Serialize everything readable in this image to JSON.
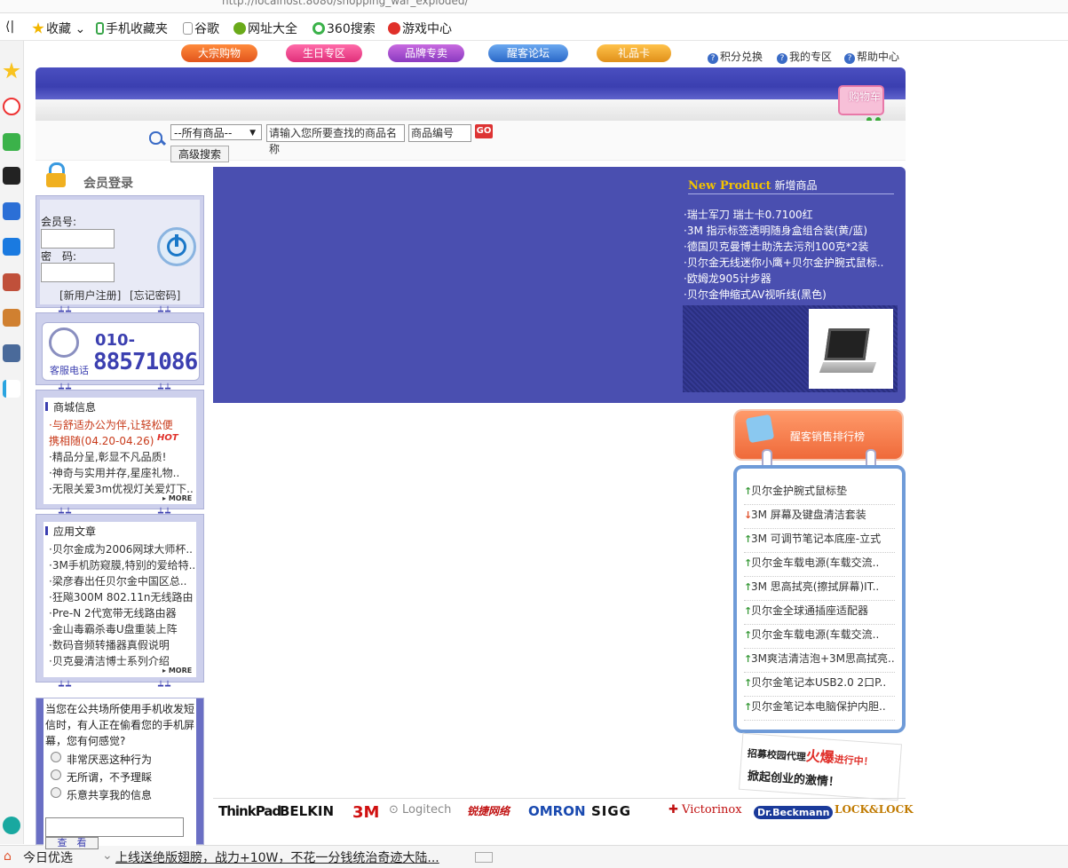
{
  "browser": {
    "url": "http://localhost:8080/shopping_war_exploded/",
    "back_label": "⟨|",
    "bookmarks": [
      {
        "label": "收藏",
        "icon": "star-icon"
      },
      {
        "label": "手机收藏夹",
        "icon": "phone-icon"
      },
      {
        "label": "谷歌",
        "icon": "page-icon"
      },
      {
        "label": "网址大全",
        "icon": "globe-icon"
      },
      {
        "label": "360搜索",
        "icon": "search360-icon"
      },
      {
        "label": "游戏中心",
        "icon": "game-icon"
      }
    ],
    "status": {
      "item1": "今日优选",
      "item2": "上线送绝版翅膀，战力+10W，不花一分钱统治奇迹大陆..."
    }
  },
  "nav": {
    "buttons": [
      "大宗购物",
      "生日专区",
      "品牌专卖",
      "醒客论坛",
      "礼品卡"
    ],
    "links": [
      "积分兑换",
      "我的专区",
      "帮助中心"
    ],
    "cart": "购物车"
  },
  "search": {
    "category": "--所有商品--",
    "keyword": "请输入您所要查找的商品名称",
    "code": "商品编号",
    "go": "GO",
    "advanced": "高级搜索"
  },
  "login": {
    "title": "会员登录",
    "member_label": "会员号:",
    "password_label": "密　码:",
    "register": "[新用户注册]",
    "forgot": "[忘记密码]"
  },
  "hotline": {
    "prefix": "010-",
    "number": "88571086",
    "caption": "客服电话"
  },
  "mall_info": {
    "title": "商城信息",
    "items": [
      "·与舒适办公为伴,让轻松便",
      "携相随(04.20-04.26)",
      "·精品分呈,彰显不凡品质!",
      "·神奇与实用并存,星座礼物..",
      "·无限关爱3m优视灯关爱灯下.."
    ],
    "hot": "HOT",
    "more": "MORE"
  },
  "articles": {
    "title": "应用文章",
    "items": [
      "·贝尔金成为2006网球大师杯..",
      "·3M手机防窥膜,特别的爱给特..",
      "·梁彦春出任贝尔金中国区总..",
      "·狂飚300M 802.11n无线路由",
      "·Pre-N 2代宽带无线路由器",
      "·金山毒霸杀毒U盘重装上阵",
      "·数码音频转播器真假说明",
      "·贝克曼清洁博士系列介绍"
    ],
    "more": "MORE"
  },
  "poll": {
    "question": "当您在公共场所使用手机收发短信时，有人正在偷看您的手机屏幕，您有何感觉?",
    "options": [
      "非常厌恶这种行为",
      "无所谓，不予理睬",
      "乐意共享我的信息"
    ],
    "view": "查　看"
  },
  "new_products": {
    "title_en": "New Product",
    "title_cn": "新增商品",
    "items": [
      "·瑞士军刀 瑞士卡0.7100红",
      "·3M 指示标签透明随身盒组合装(黄/蓝)",
      "·德国贝克曼博士助洗去污剂100克*2装",
      "·贝尔金无线迷你小鹰+贝尔金护腕式鼠标..",
      "·欧姆龙905计步器",
      "·贝尔金伸缩式AV视听线(黑色)"
    ]
  },
  "ranking": {
    "title": "醒客销售排行榜",
    "items": [
      {
        "label": "贝尔金护腕式鼠标垫",
        "trend": "up"
      },
      {
        "label": "3M 屏幕及键盘清洁套装",
        "trend": "down"
      },
      {
        "label": "3M 可调节笔记本底座-立式",
        "trend": "up"
      },
      {
        "label": "贝尔金车载电源(车载交流..",
        "trend": "up"
      },
      {
        "label": "3M 思高拭亮(擦拭屏幕)IT..",
        "trend": "up"
      },
      {
        "label": "贝尔金全球通插座适配器",
        "trend": "up"
      },
      {
        "label": "贝尔金车载电源(车载交流..",
        "trend": "up"
      },
      {
        "label": "3M爽洁清洁泡+3M思高拭亮..",
        "trend": "up"
      },
      {
        "label": "贝尔金笔记本USB2.0 2口P..",
        "trend": "up"
      },
      {
        "label": "贝尔金笔记本电脑保护内胆..",
        "trend": "up"
      }
    ]
  },
  "promo": {
    "line1": "招募校园代理",
    "hot": "火爆",
    "line1b": "进行中！",
    "line2": "掀起创业的激情！"
  },
  "brands": [
    "ThinkPad",
    "BELKIN",
    "3M",
    "Logitech",
    "锐捷网络",
    "OMRON",
    "SIGG",
    "Victorinox",
    "Dr.Beckmann",
    "LOCK&LOCK"
  ],
  "colors": {
    "brand_blue": "#4a4fb0",
    "accent_orange": "#ef6a3a",
    "up_arrow": "#3a9a3a",
    "down_arrow": "#e0502a"
  }
}
